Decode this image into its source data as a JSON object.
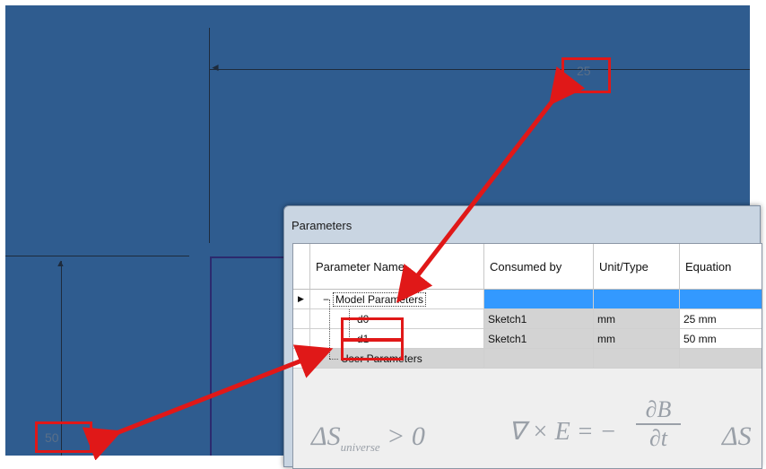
{
  "drawing": {
    "dim_horizontal_value": "25",
    "dim_vertical_value": "50"
  },
  "dialog": {
    "title": "Parameters",
    "columns": [
      "Parameter Name",
      "Consumed by",
      "Unit/Type",
      "Equation"
    ],
    "groups": {
      "model": "Model Parameters",
      "user": "User Parameters"
    },
    "rows": [
      {
        "name": "d0",
        "consumed_by": "Sketch1",
        "unit": "mm",
        "equation": "25 mm"
      },
      {
        "name": "d1",
        "consumed_by": "Sketch1",
        "unit": "mm",
        "equation": "50 mm"
      }
    ],
    "expand_toggle": "−",
    "background_formula_left": "ΔS",
    "background_formula_left_sub": "universe",
    "background_formula_left_rel": "> 0",
    "background_formula_mid": "∇ × E = −",
    "background_formula_frac_top": "∂B",
    "background_formula_frac_bottom": "∂t",
    "background_formula_right": "ΔS"
  },
  "colors": {
    "canvas": "#2f5c8f",
    "annotation": "#e01818",
    "selection": "#3399ff"
  }
}
